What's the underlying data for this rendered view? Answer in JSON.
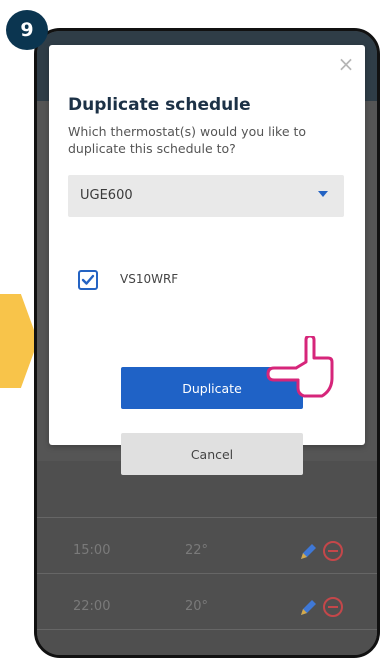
{
  "step": {
    "number": "9"
  },
  "dialog": {
    "close_symbol": "×",
    "title": "Duplicate schedule",
    "subtitle": "Which thermostat(s) would you like to duplicate this schedule to?",
    "select": {
      "value": "UGE600"
    },
    "checkbox": {
      "label": "VS10WRF",
      "checked": true
    },
    "buttons": {
      "duplicate_label": "Duplicate",
      "cancel_label": "Cancel"
    }
  },
  "background_schedule": {
    "rows": [
      {
        "time": "",
        "temp": ""
      },
      {
        "time": "15:00",
        "temp": "22°"
      },
      {
        "time": "22:00",
        "temp": "20°"
      },
      {
        "time": "",
        "temp": ""
      }
    ]
  },
  "colors": {
    "accent": "#1f62c6",
    "badge": "#0b3550",
    "arrow": "#f8c44a",
    "hand": "#d6257a",
    "danger": "#c4474a"
  }
}
